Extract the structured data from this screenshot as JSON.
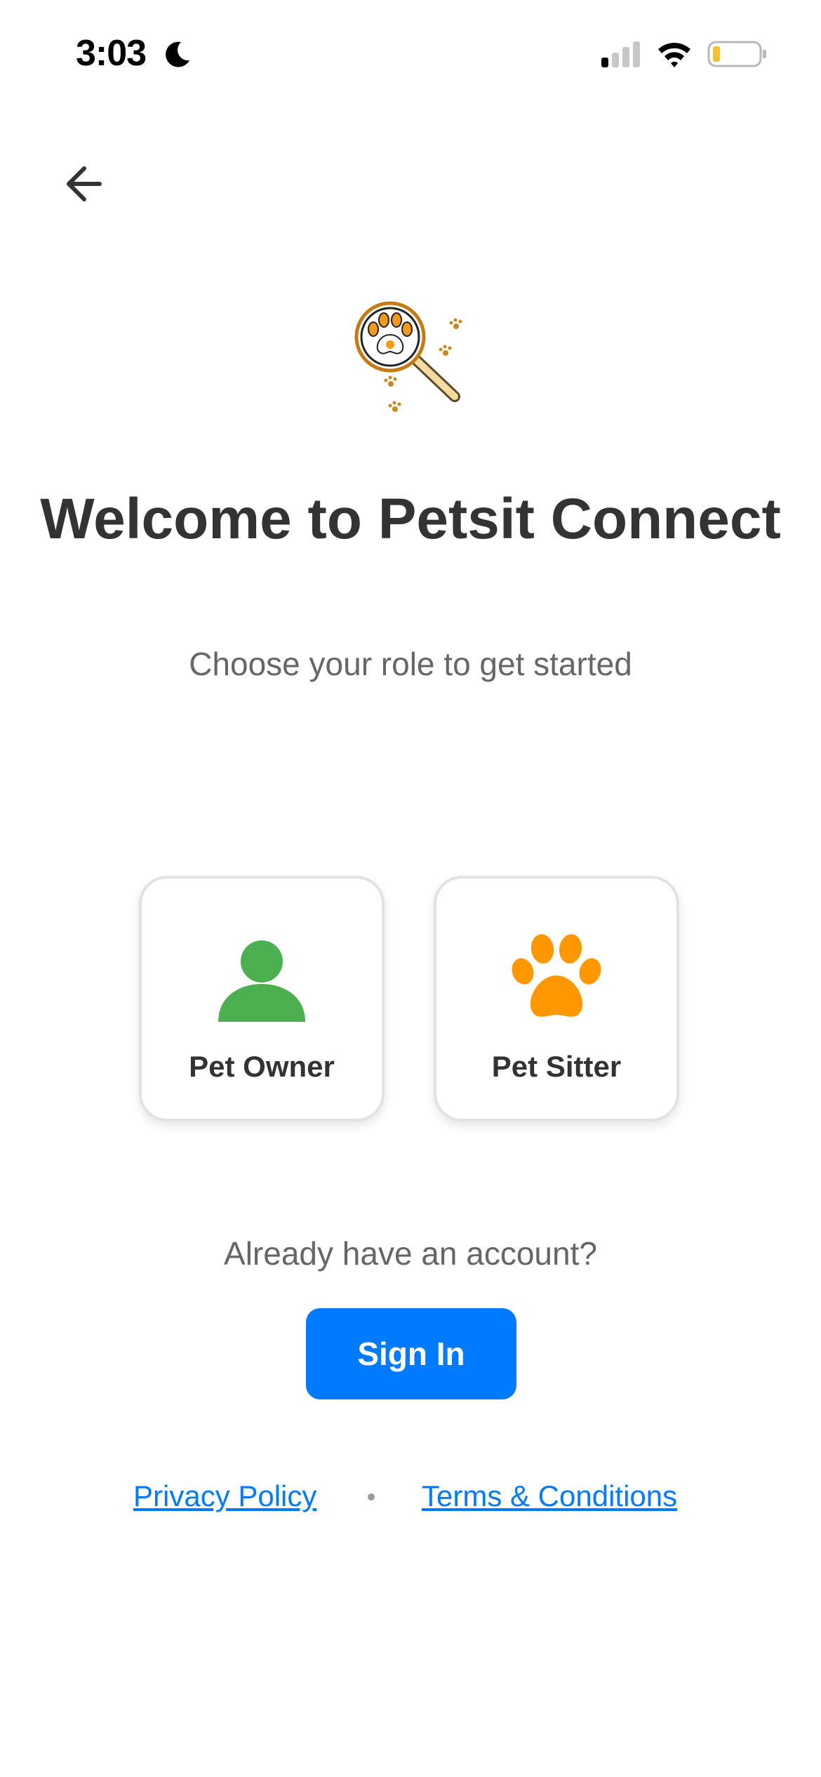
{
  "status_bar": {
    "time": "3:03",
    "icons": [
      "moon-icon",
      "signal-icon",
      "wifi-icon",
      "battery-icon"
    ]
  },
  "navigation": {
    "back_icon": "arrow-left-icon"
  },
  "logo": {
    "icon": "magnifier-paw-logo"
  },
  "header": {
    "title": "Welcome to Petsit Connect",
    "subtitle": "Choose your role to get started"
  },
  "roles": [
    {
      "label": "Pet Owner",
      "icon": "person-icon",
      "color": "#4caf50"
    },
    {
      "label": "Pet Sitter",
      "icon": "paw-icon",
      "color": "#ff9800"
    }
  ],
  "auth": {
    "prompt": "Already have an account?",
    "sign_in_label": "Sign In",
    "button_color": "#007aff"
  },
  "footer": {
    "privacy_label": "Privacy Policy",
    "separator": "•",
    "terms_label": "Terms & Conditions"
  }
}
